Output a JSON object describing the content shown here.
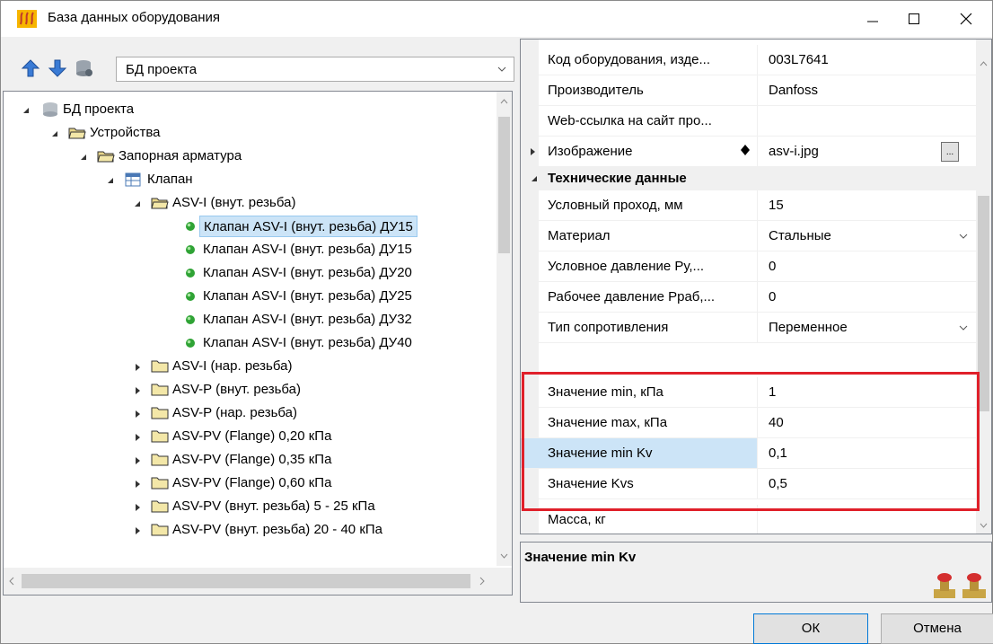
{
  "window": {
    "title": "База данных оборудования"
  },
  "toolbar": {
    "database_combo_value": "БД проекта"
  },
  "tree": {
    "items": [
      {
        "label": "БД проекта",
        "icon": "database-icon"
      },
      {
        "label": "Устройства",
        "icon": "folder-open-icon"
      },
      {
        "label": "Запорная арматура",
        "icon": "folder-open-icon"
      },
      {
        "label": "Клапан",
        "icon": "table-icon"
      },
      {
        "label": "ASV-I (внут. резьба)",
        "icon": "folder-open-icon"
      },
      {
        "label": "Клапан ASV-I (внут. резьба) ДУ15",
        "icon": "green-dot-icon"
      },
      {
        "label": "Клапан ASV-I (внут. резьба) ДУ15",
        "icon": "green-dot-icon"
      },
      {
        "label": "Клапан ASV-I (внут. резьба) ДУ20",
        "icon": "green-dot-icon"
      },
      {
        "label": "Клапан ASV-I (внут. резьба) ДУ25",
        "icon": "green-dot-icon"
      },
      {
        "label": "Клапан ASV-I (внут. резьба) ДУ32",
        "icon": "green-dot-icon"
      },
      {
        "label": "Клапан ASV-I (внут. резьба) ДУ40",
        "icon": "green-dot-icon"
      },
      {
        "label": "ASV-I (нар. резьба)",
        "icon": "folder-icon"
      },
      {
        "label": "ASV-P (внут. резьба)",
        "icon": "folder-icon"
      },
      {
        "label": "ASV-P (нар. резьба)",
        "icon": "folder-icon"
      },
      {
        "label": "ASV-PV (Flange) 0,20 кПа",
        "icon": "folder-icon"
      },
      {
        "label": "ASV-PV (Flange) 0,35 кПа",
        "icon": "folder-icon"
      },
      {
        "label": "ASV-PV (Flange) 0,60 кПа",
        "icon": "folder-icon"
      },
      {
        "label": "ASV-PV (внут. резьба) 5 - 25 кПа",
        "icon": "folder-icon"
      },
      {
        "label": "ASV-PV (внут. резьба) 20 - 40 кПа",
        "icon": "folder-icon"
      }
    ]
  },
  "properties": {
    "rows": [
      {
        "name": "Код оборудования, изде...",
        "value": "003L7641"
      },
      {
        "name": "Производитель",
        "value": "Danfoss"
      },
      {
        "name": "Web-ссылка на сайт про...",
        "value": ""
      },
      {
        "name": "Изображение",
        "value": "asv-i.jpg"
      },
      {
        "name": "Технические данные",
        "value": ""
      },
      {
        "name": "Условный проход, мм",
        "value": "15"
      },
      {
        "name": "Материал",
        "value": "Стальные"
      },
      {
        "name": "Условное давление Ру,...",
        "value": "0"
      },
      {
        "name": "Рабочее давление Рраб,...",
        "value": "0"
      },
      {
        "name": "Тип сопротивления",
        "value": "Переменное"
      },
      {
        "name": "Значение min, кПа",
        "value": "1"
      },
      {
        "name": "Значение max, кПа",
        "value": "40"
      },
      {
        "name": "Значение min Kv",
        "value": "0,1"
      },
      {
        "name": "Значение Kvs",
        "value": "0,5"
      },
      {
        "name": "Масса, кг",
        "value": ""
      }
    ],
    "ellipsis": "..."
  },
  "description": {
    "title": "Значение min Kv"
  },
  "buttons": {
    "ok": "ОК",
    "cancel": "Отмена"
  },
  "colors": {
    "highlight_border": "#e0202a",
    "selection": "#cce4f7"
  }
}
